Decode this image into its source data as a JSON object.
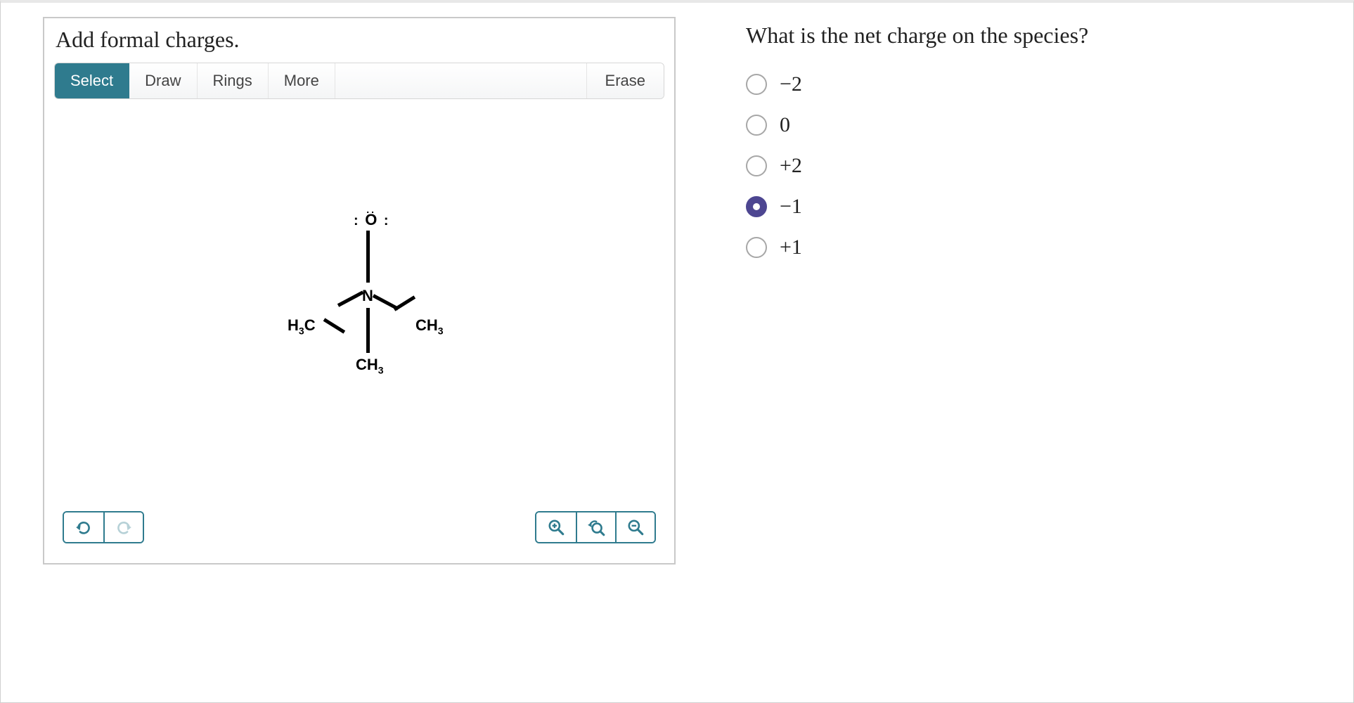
{
  "instruction": "Add formal charges.",
  "toolbar": {
    "select": "Select",
    "draw": "Draw",
    "rings": "Rings",
    "more": "More",
    "erase": "Erase",
    "active": "select"
  },
  "molecule": {
    "atoms": {
      "O": {
        "label": "O",
        "lone_pairs": 3
      },
      "N": {
        "label": "N"
      },
      "H3C_left": {
        "label": "H3C"
      },
      "CH3_right": {
        "label": "CH3"
      },
      "CH3_bottom": {
        "label": "CH3"
      }
    },
    "bonds": [
      {
        "from": "O",
        "to": "N",
        "order": 1
      },
      {
        "from": "N",
        "to": "H3C_left",
        "order": 1
      },
      {
        "from": "N",
        "to": "CH3_right",
        "order": 1
      },
      {
        "from": "N",
        "to": "CH3_bottom",
        "order": 1
      }
    ]
  },
  "bottom_icons": {
    "undo": "undo",
    "redo": "redo",
    "zoom_in": "zoom-in",
    "zoom_reset": "zoom-reset",
    "zoom_out": "zoom-out"
  },
  "question": {
    "text": "What is the net charge on the species?",
    "options": [
      {
        "value": "−2",
        "selected": false
      },
      {
        "value": "0",
        "selected": false
      },
      {
        "value": "+2",
        "selected": false
      },
      {
        "value": "−1",
        "selected": true
      },
      {
        "value": "+1",
        "selected": false
      }
    ]
  }
}
